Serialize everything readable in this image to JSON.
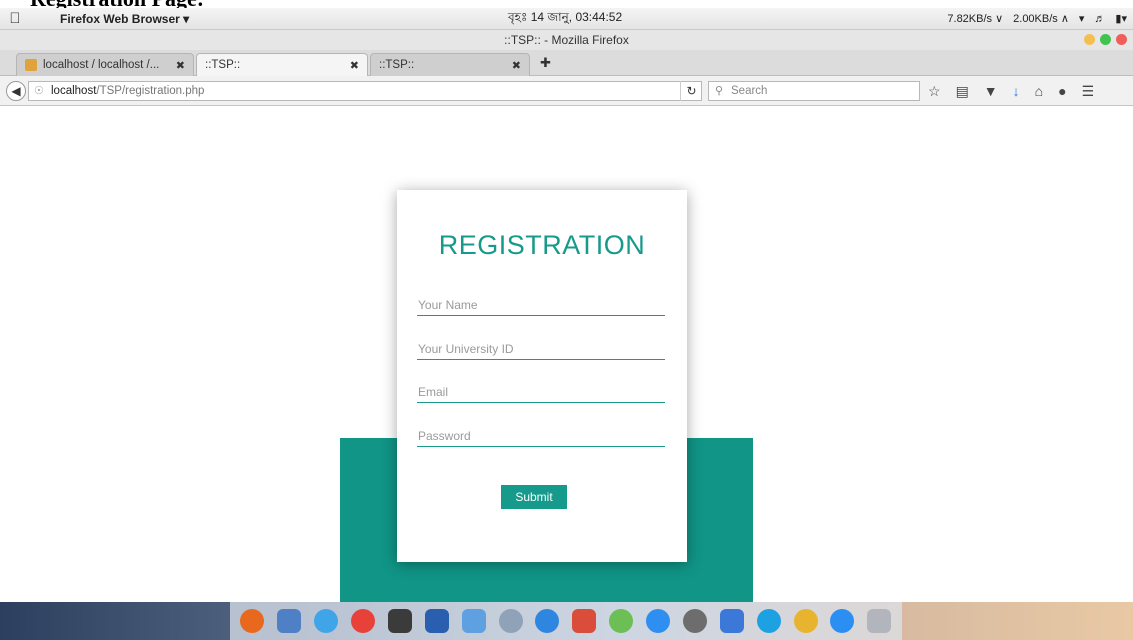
{
  "caption": "Registration Page:",
  "menubar": {
    "app_name": "Firefox Web Browser ▾",
    "clock": "বৃহঃ 14 জানু, 03:44:52",
    "net_down": "7.82KB/s ∨",
    "net_up": "2.00KB/s ∧"
  },
  "window": {
    "title": "::TSP:: - Mozilla Firefox"
  },
  "tabs": [
    {
      "label": "localhost / localhost /...",
      "close": "✖"
    },
    {
      "label": "::TSP::",
      "close": "✖"
    },
    {
      "label": "::TSP::",
      "close": ""
    }
  ],
  "navbar": {
    "url_host": "localhost",
    "url_path": "/TSP/registration.php",
    "search_placeholder": "Search"
  },
  "form": {
    "title": "REGISTRATION",
    "fields": [
      {
        "placeholder": "Your Name"
      },
      {
        "placeholder": "Your University ID"
      },
      {
        "placeholder": "Email"
      },
      {
        "placeholder": "Password"
      }
    ],
    "submit_label": "Submit"
  },
  "colors": {
    "accent": "#169a8c",
    "teal_block": "#109586"
  },
  "dock_icons": [
    "firefox-icon",
    "image-viewer-icon",
    "messages-icon",
    "music-icon",
    "camera-icon",
    "word-icon",
    "finder-icon",
    "settings-icon",
    "app-store-icon",
    "photos-icon",
    "maps-icon",
    "messenger-icon",
    "disk-icon",
    "bluetooth-icon",
    "skype-icon",
    "chrome-icon",
    "messenger-alt-icon",
    "launchpad-icon"
  ]
}
